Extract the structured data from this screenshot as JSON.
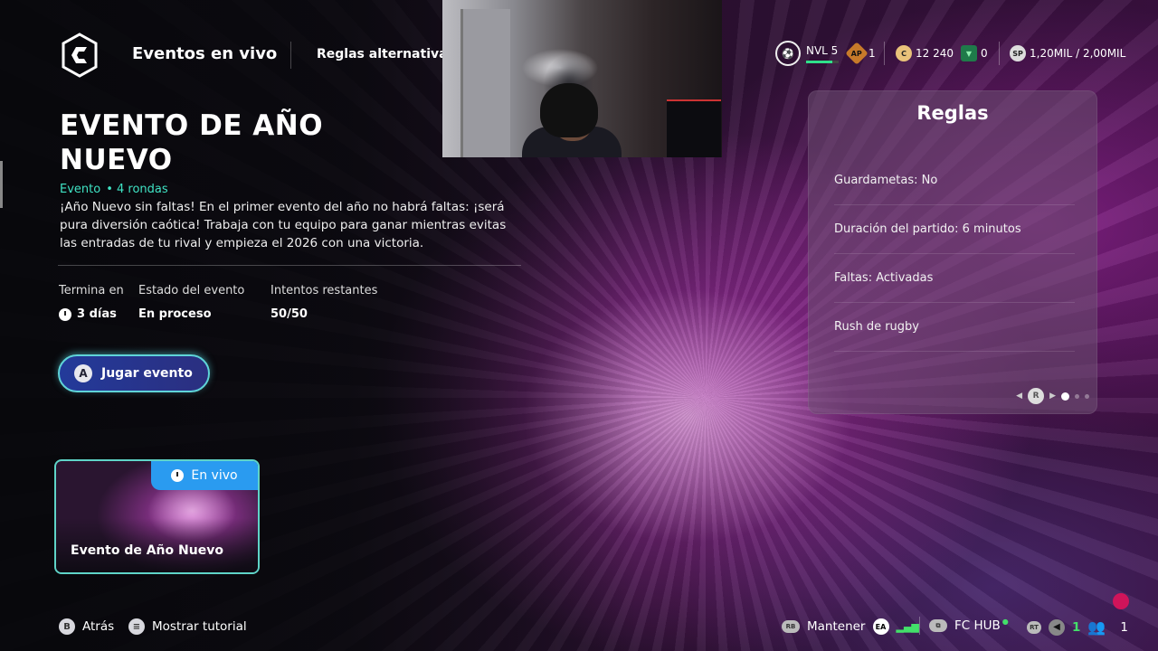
{
  "header": {
    "nav_live": "Eventos en vivo",
    "nav_alt": "Reglas alternativas"
  },
  "hud": {
    "level": "NVL 5",
    "level_progress": 0.8,
    "ap_count": "1",
    "coins": "12 240",
    "points": "0",
    "sp": "1,20MIL / 2,00MIL"
  },
  "event": {
    "title_line1": "EVENTO DE AÑO",
    "title_line2": "NUEVO",
    "type": "Evento",
    "rounds": "• 4 rondas",
    "description": "¡Año Nuevo sin faltas! En el primer evento del año no habrá faltas: ¡será pura diversión caótica! Trabaja con tu equipo para ganar mientras evitas las entradas de tu rival y empieza el 2026 con una victoria.",
    "stats": {
      "ends_label": "Termina en",
      "ends_value": "3 días",
      "status_label": "Estado del evento",
      "status_value": "En proceso",
      "attempts_label": "Intentos restantes",
      "attempts_value": "50/50"
    },
    "play_button": "Jugar evento",
    "play_key": "A"
  },
  "event_card": {
    "badge": "En vivo",
    "title": "Evento de Año Nuevo"
  },
  "rules": {
    "title": "Reglas",
    "items": [
      "Guardametas: No",
      "Duración del partido: 6 minutos",
      "Faltas: Activadas",
      "Rush de rugby"
    ],
    "pager_key": "R"
  },
  "footer": {
    "back_key": "B",
    "back_label": "Atrás",
    "tutorial_label": "Mostrar tutorial",
    "hold_key": "RB",
    "hold_label": "Mantener",
    "ea_label": "EA",
    "hub_label": "FC HUB",
    "rt_key": "RT",
    "voice_count": "1",
    "friends_count": "1"
  },
  "colors": {
    "accent_teal": "#3fe3c4",
    "live_badge": "#2a9bf0",
    "green": "#43e06a"
  }
}
